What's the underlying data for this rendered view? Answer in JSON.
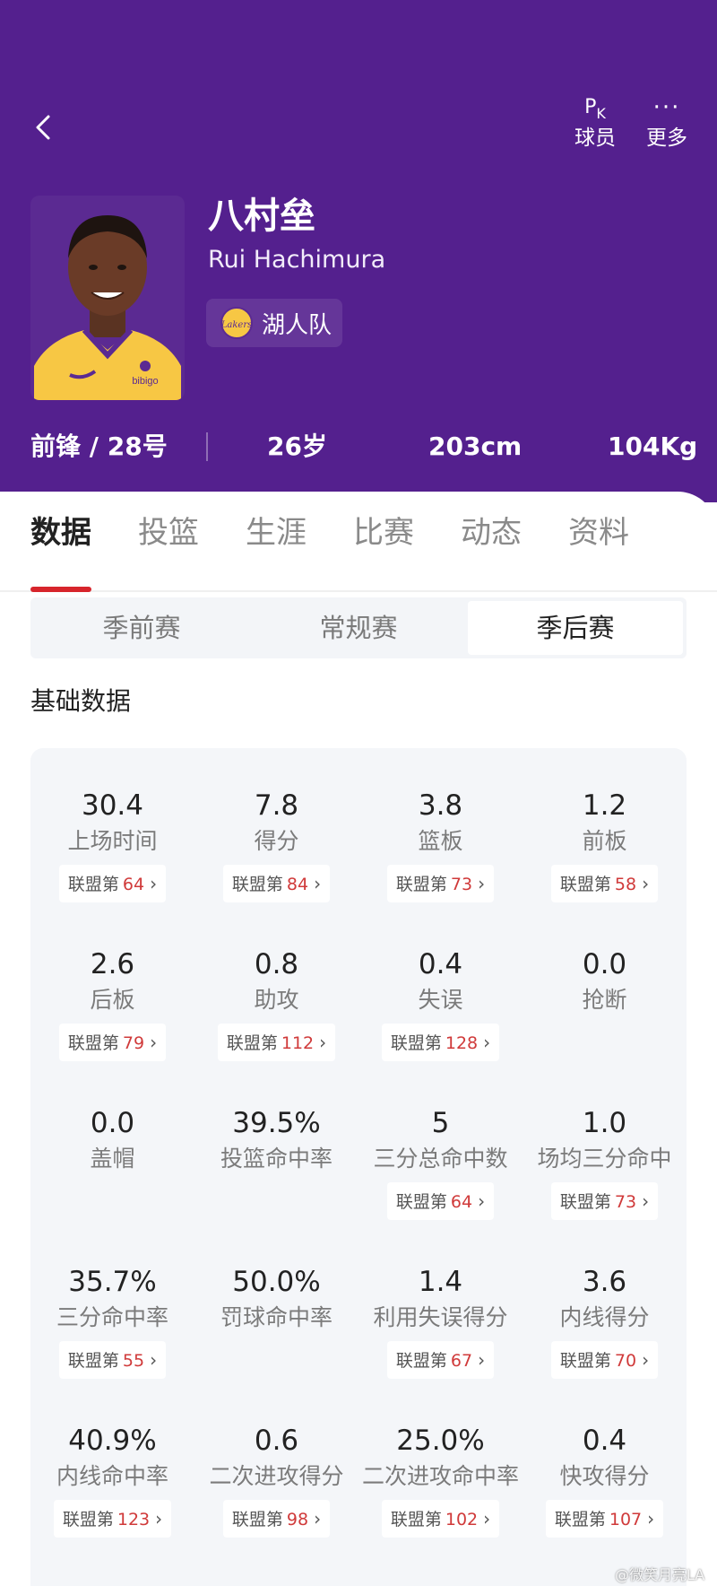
{
  "header": {
    "pk_glyph_main": "P",
    "pk_glyph_sub": "K",
    "pk_label": "球员",
    "more_glyph": "···",
    "more_label": "更多",
    "player_name": "八村垒",
    "player_name_en": "Rui Hachimura",
    "team_name": "湖人队",
    "team_logo_text": "Lakers",
    "position_number": "前锋 / 28号",
    "age": "26岁",
    "height": "203cm",
    "weight": "104Kg",
    "jersey_text": "bibigo",
    "colors": {
      "header_bg": "#54208e",
      "jersey": "#f7c744",
      "accent_red": "#d7252c"
    }
  },
  "tabs": [
    "数据",
    "投篮",
    "生涯",
    "比赛",
    "动态",
    "资料"
  ],
  "active_tab": "数据",
  "segments": [
    "季前赛",
    "常规赛",
    "季后赛"
  ],
  "active_segment": "季后赛",
  "section_title": "基础数据",
  "rank_prefix": "联盟第",
  "stats": [
    {
      "value": "30.4",
      "label": "上场时间",
      "rank": "64"
    },
    {
      "value": "7.8",
      "label": "得分",
      "rank": "84"
    },
    {
      "value": "3.8",
      "label": "篮板",
      "rank": "73"
    },
    {
      "value": "1.2",
      "label": "前板",
      "rank": "58"
    },
    {
      "value": "2.6",
      "label": "后板",
      "rank": "79"
    },
    {
      "value": "0.8",
      "label": "助攻",
      "rank": "112"
    },
    {
      "value": "0.4",
      "label": "失误",
      "rank": "128"
    },
    {
      "value": "0.0",
      "label": "抢断",
      "rank": null
    },
    {
      "value": "0.0",
      "label": "盖帽",
      "rank": null
    },
    {
      "value": "39.5%",
      "label": "投篮命中率",
      "rank": null
    },
    {
      "value": "5",
      "label": "三分总命中数",
      "rank": "64"
    },
    {
      "value": "1.0",
      "label": "场均三分命中",
      "rank": "73"
    },
    {
      "value": "35.7%",
      "label": "三分命中率",
      "rank": "55"
    },
    {
      "value": "50.0%",
      "label": "罚球命中率",
      "rank": null
    },
    {
      "value": "1.4",
      "label": "利用失误得分",
      "rank": "67"
    },
    {
      "value": "3.6",
      "label": "内线得分",
      "rank": "70"
    },
    {
      "value": "40.9%",
      "label": "内线命中率",
      "rank": "123"
    },
    {
      "value": "0.6",
      "label": "二次进攻得分",
      "rank": "98"
    },
    {
      "value": "25.0%",
      "label": "二次进攻命中率",
      "rank": "102"
    },
    {
      "value": "0.4",
      "label": "快攻得分",
      "rank": "107"
    }
  ],
  "watermark": "@微笑月亮LA"
}
